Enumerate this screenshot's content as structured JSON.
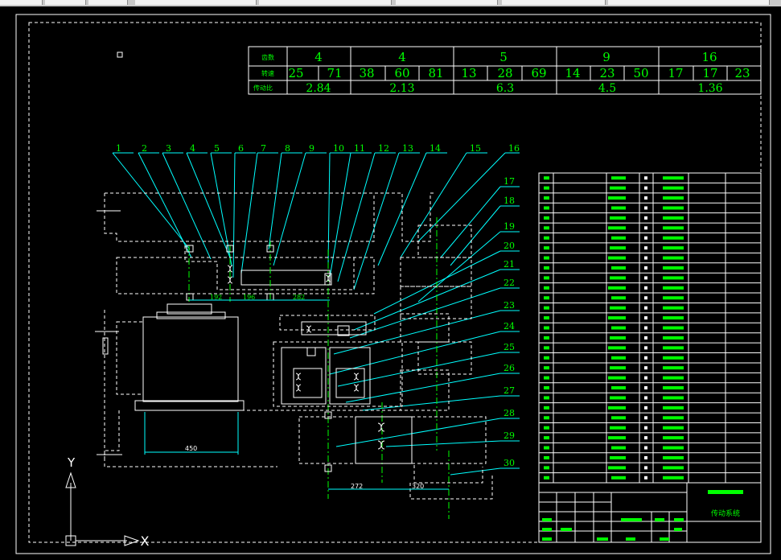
{
  "gear_table": {
    "row_labels": [
      "齿数",
      "转速",
      "传动比"
    ],
    "groups": [
      {
        "count": "4",
        "speeds": [
          "25",
          "71"
        ],
        "ratio": "2.84"
      },
      {
        "count": "4",
        "speeds": [
          "38",
          "60",
          "81"
        ],
        "ratio": "2.13"
      },
      {
        "count": "5",
        "speeds": [
          "13",
          "28",
          "69"
        ],
        "ratio": "6.3"
      },
      {
        "count": "9",
        "speeds": [
          "14",
          "23",
          "50"
        ],
        "ratio": "4.5"
      },
      {
        "count": "16",
        "speeds": [
          "17",
          "17",
          "23"
        ],
        "ratio": "1.36"
      }
    ]
  },
  "leader_numbers": [
    "1",
    "2",
    "3",
    "4",
    "5",
    "6",
    "7",
    "8",
    "9",
    "10",
    "11",
    "12",
    "13",
    "14",
    "15",
    "16",
    "17",
    "18",
    "19",
    "20",
    "21",
    "22",
    "23",
    "24",
    "25",
    "26",
    "27",
    "28",
    "29",
    "30"
  ],
  "dimensions": {
    "d192": "192",
    "d196": "196",
    "d282": "282",
    "d450": "450",
    "d272": "272",
    "d320": "320"
  },
  "ucs": {
    "y_label": "Y",
    "x_marker": "X"
  },
  "title_block": {
    "title": "传动系统"
  },
  "colors": {
    "background": "#000000",
    "text": "#00ff00",
    "lines": "#ffffff",
    "leaders": "#00ffff"
  }
}
